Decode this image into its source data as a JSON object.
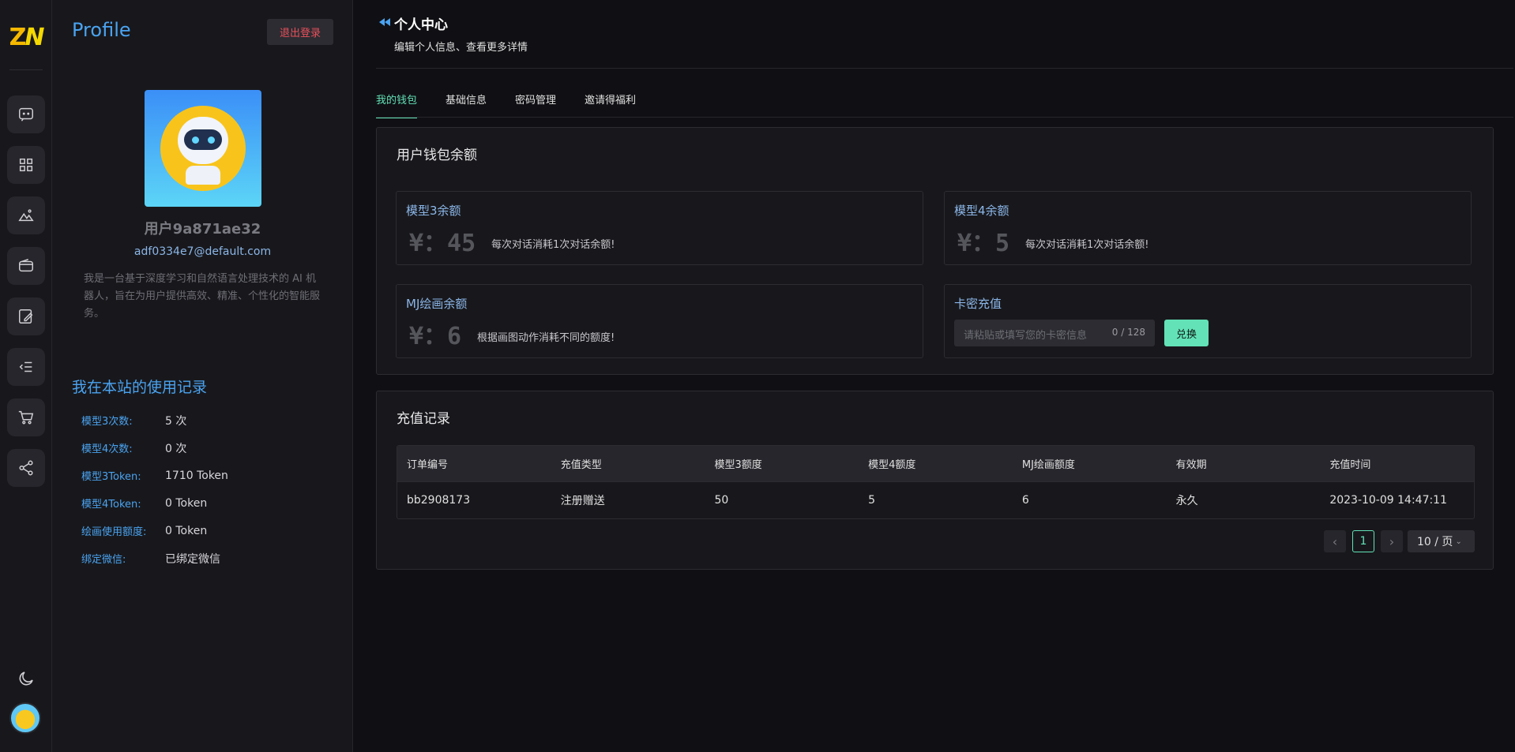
{
  "rail": {
    "logo_z": "Z",
    "logo_n": "N",
    "icons": [
      "chat-icon",
      "apps-icon",
      "image-icon",
      "wallet-icon",
      "draw-icon",
      "list-icon",
      "cart-icon",
      "share-icon"
    ]
  },
  "profile": {
    "title": "Profile",
    "logout_label": "退出登录",
    "username": "用户9a871ae32",
    "email": "adf0334e7@default.com",
    "bio": "我是一台基于深度学习和自然语言处理技术的 AI 机器人，旨在为用户提供高效、精准、个性化的智能服务。",
    "usage_title": "我在本站的使用记录",
    "usage": [
      {
        "label": "模型3次数:",
        "value": "5 次"
      },
      {
        "label": "模型4次数:",
        "value": "0 次"
      },
      {
        "label": "模型3Token:",
        "value": "1710 Token"
      },
      {
        "label": "模型4Token:",
        "value": "0 Token"
      },
      {
        "label": "绘画使用额度:",
        "value": "0 Token"
      },
      {
        "label": "绑定微信:",
        "value": "已绑定微信"
      }
    ]
  },
  "header": {
    "title": "个人中心",
    "subtitle": "编辑个人信息、查看更多详情"
  },
  "tabs": [
    {
      "label": "我的钱包",
      "active": true
    },
    {
      "label": "基础信息",
      "active": false
    },
    {
      "label": "密码管理",
      "active": false
    },
    {
      "label": "邀请得福利",
      "active": false
    }
  ],
  "wallet": {
    "title": "用户钱包余额",
    "model3": {
      "label": "模型3余额",
      "amount": "¥：45",
      "hint": "每次对话消耗1次对话余额!"
    },
    "model4": {
      "label": "模型4余额",
      "amount": "¥：5",
      "hint": "每次对话消耗1次对话余额!"
    },
    "mj": {
      "label": "MJ绘画余额",
      "amount": "¥：6",
      "hint": "根据画图动作消耗不同的额度!"
    },
    "card": {
      "label": "卡密充值",
      "placeholder": "请粘贴或填写您的卡密信息",
      "count": "0 / 128",
      "redeem_label": "兑换"
    }
  },
  "records": {
    "title": "充值记录",
    "columns": [
      "订单编号",
      "充值类型",
      "模型3额度",
      "模型4额度",
      "MJ绘画额度",
      "有效期",
      "充值时间"
    ],
    "rows": [
      [
        "bb2908173",
        "注册赠送",
        "50",
        "5",
        "6",
        "永久",
        "2023-10-09 14:47:11"
      ]
    ],
    "pagination": {
      "prev": "‹",
      "current_page": "1",
      "next": "›",
      "page_size": "10 / 页"
    }
  },
  "colors": {
    "accent": "#63e2b7",
    "link": "#4aa3f0",
    "danger": "#e8505b",
    "background": "#101014"
  }
}
